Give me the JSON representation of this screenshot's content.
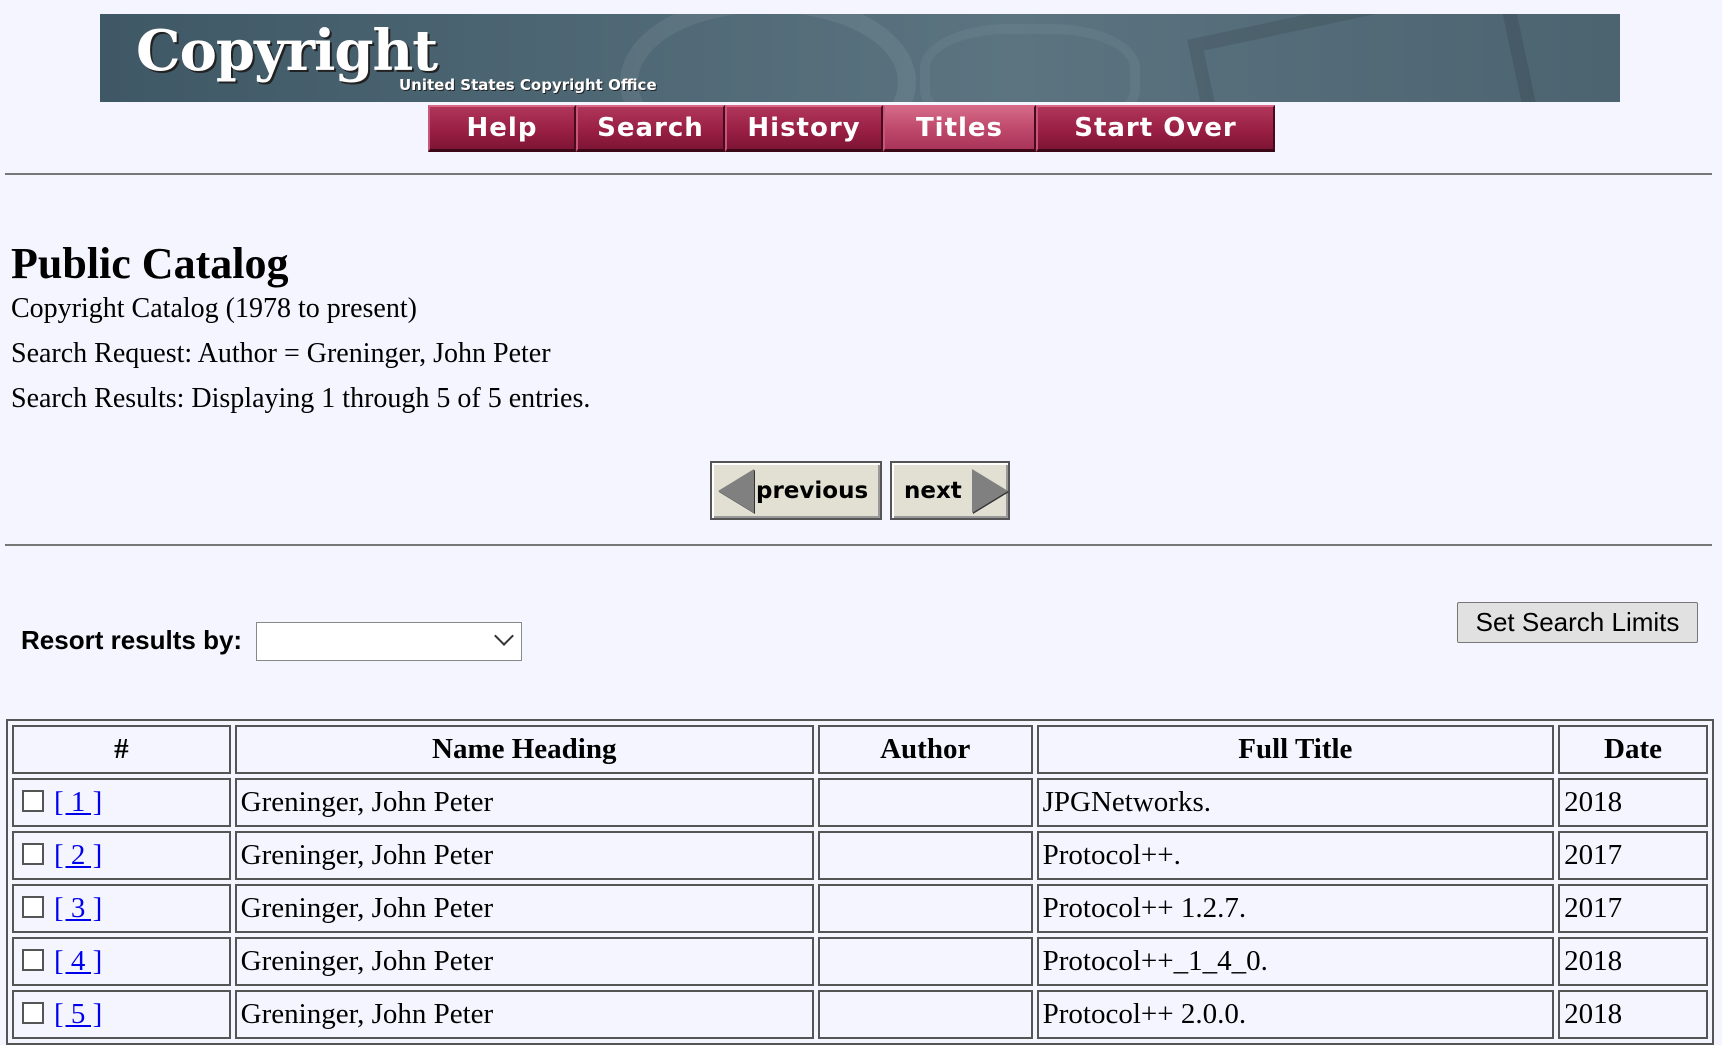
{
  "banner": {
    "logo_word": "Copyright",
    "logo_sub": "United States Copyright Office"
  },
  "nav": {
    "help": "Help",
    "search": "Search",
    "history": "History",
    "titles": "Titles",
    "start_over": "Start Over"
  },
  "page": {
    "title": "Public Catalog",
    "catalog": "Copyright Catalog (1978 to present)",
    "search_request": "Search Request: Author = Greninger, John Peter",
    "search_results": "Search Results: Displaying 1 through 5 of 5 entries."
  },
  "pager": {
    "previous": "previous",
    "next": "next"
  },
  "controls": {
    "resort_label": "Resort results by:",
    "resort_value": "",
    "set_limits": "Set Search Limits"
  },
  "table": {
    "headers": [
      "#",
      "Name Heading",
      "Author",
      "Full Title",
      "Date"
    ],
    "rows": [
      {
        "num": "[ 1 ]",
        "name": "Greninger, John Peter",
        "author": "",
        "title": "JPGNetworks.",
        "date": "2018"
      },
      {
        "num": "[ 2 ]",
        "name": "Greninger, John Peter",
        "author": "",
        "title": "Protocol++.",
        "date": "2017"
      },
      {
        "num": "[ 3 ]",
        "name": "Greninger, John Peter",
        "author": "",
        "title": "Protocol++ 1.2.7.",
        "date": "2017"
      },
      {
        "num": "[ 4 ]",
        "name": "Greninger, John Peter",
        "author": "",
        "title": "Protocol++_1_4_0.",
        "date": "2018"
      },
      {
        "num": "[ 5 ]",
        "name": "Greninger, John Peter",
        "author": "",
        "title": "Protocol++ 2.0.0.",
        "date": "2018"
      }
    ]
  }
}
